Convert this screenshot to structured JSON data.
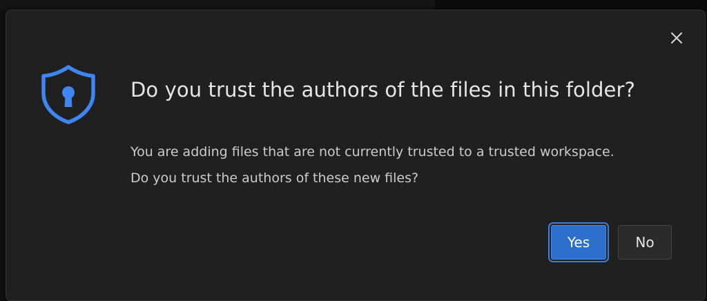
{
  "dialog": {
    "title": "Do you trust the authors of the files in this folder?",
    "message": "You are adding files that are not currently trusted to a trusted workspace. Do you trust the authors of these new files?",
    "icon": "shield-keyhole-icon",
    "close_icon": "close-icon",
    "buttons": {
      "yes_label": "Yes",
      "no_label": "No"
    }
  },
  "colors": {
    "accent": "#2d6fcc",
    "icon": "#3f86f0",
    "background": "#202020"
  }
}
